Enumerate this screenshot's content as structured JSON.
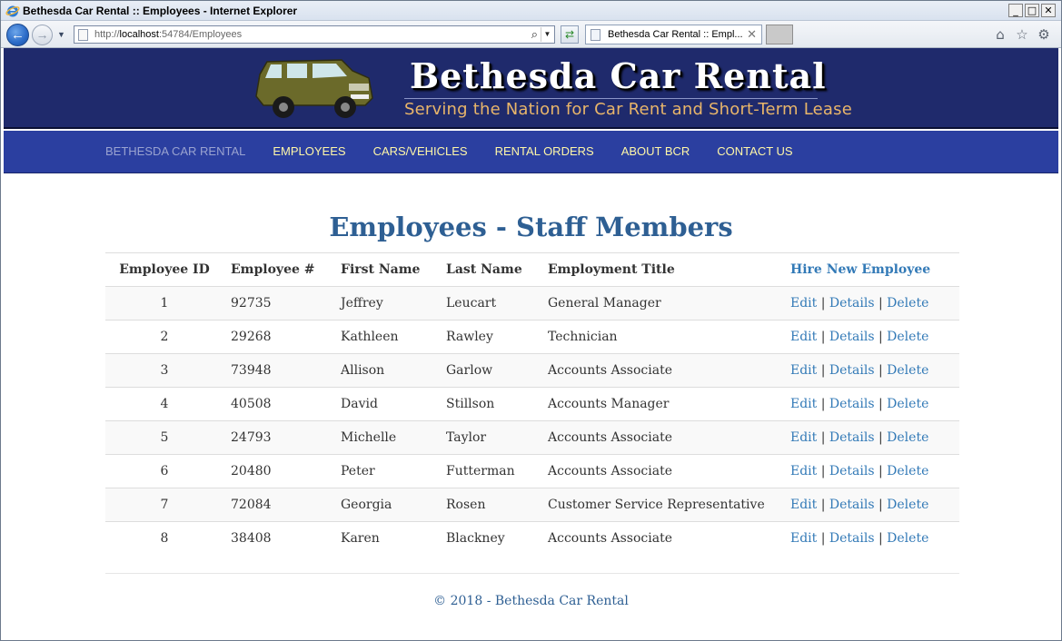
{
  "window": {
    "title": "Bethesda Car Rental :: Employees - Internet Explorer",
    "minimize": "_",
    "maximize": "□",
    "close": "✕"
  },
  "browser": {
    "url_prefix": "http://",
    "url_host": "localhost",
    "url_rest": ":54784/Employees",
    "tab_title": "Bethesda Car Rental :: Empl...",
    "tab_close": "✕",
    "icons": [
      "back-icon",
      "forward-icon",
      "search-icon",
      "refresh-icon",
      "home-icon",
      "favorites-star-icon",
      "settings-gear-icon"
    ]
  },
  "banner": {
    "brand": "Bethesda Car Rental",
    "slogan": "Serving the Nation for Car Rent and Short-Term Lease"
  },
  "nav": {
    "items": [
      "BETHESDA CAR RENTAL",
      "EMPLOYEES",
      "CARS/VEHICLES",
      "RENTAL ORDERS",
      "ABOUT BCR",
      "CONTACT US"
    ]
  },
  "main": {
    "heading": "Employees - Staff Members",
    "columns": [
      "Employee ID",
      "Employee #",
      "First Name",
      "Last Name",
      "Employment Title"
    ],
    "hire_link": "Hire New Employee",
    "action_labels": {
      "edit": "Edit",
      "details": "Details",
      "delete": "Delete",
      "sep": "|"
    },
    "rows": [
      {
        "id": "1",
        "number": "92735",
        "first": "Jeffrey",
        "last": "Leucart",
        "title": "General Manager"
      },
      {
        "id": "2",
        "number": "29268",
        "first": "Kathleen",
        "last": "Rawley",
        "title": "Technician"
      },
      {
        "id": "3",
        "number": "73948",
        "first": "Allison",
        "last": "Garlow",
        "title": "Accounts Associate"
      },
      {
        "id": "4",
        "number": "40508",
        "first": "David",
        "last": "Stillson",
        "title": "Accounts Manager"
      },
      {
        "id": "5",
        "number": "24793",
        "first": "Michelle",
        "last": "Taylor",
        "title": "Accounts Associate"
      },
      {
        "id": "6",
        "number": "20480",
        "first": "Peter",
        "last": "Futterman",
        "title": "Accounts Associate"
      },
      {
        "id": "7",
        "number": "72084",
        "first": "Georgia",
        "last": "Rosen",
        "title": "Customer Service Representative"
      },
      {
        "id": "8",
        "number": "38408",
        "first": "Karen",
        "last": "Blackney",
        "title": "Accounts Associate"
      }
    ]
  },
  "footer": {
    "copyright": "© 2018 - Bethesda Car Rental"
  },
  "colors": {
    "banner": "#1f2a6c",
    "navbar": "#2b3fa0",
    "nav_text": "#fff7a8",
    "heading": "#2e5f93",
    "link": "#337ab7",
    "slogan": "#e8b56a"
  }
}
